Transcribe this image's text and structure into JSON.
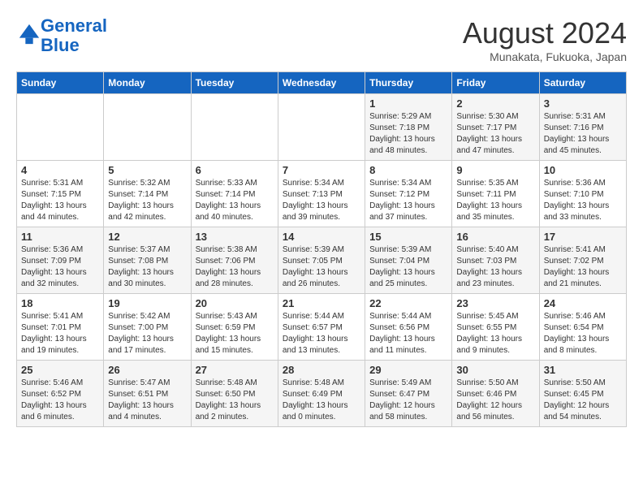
{
  "header": {
    "logo_line1": "General",
    "logo_line2": "Blue",
    "month": "August 2024",
    "location": "Munakata, Fukuoka, Japan"
  },
  "weekdays": [
    "Sunday",
    "Monday",
    "Tuesday",
    "Wednesday",
    "Thursday",
    "Friday",
    "Saturday"
  ],
  "weeks": [
    [
      {
        "day": "",
        "info": ""
      },
      {
        "day": "",
        "info": ""
      },
      {
        "day": "",
        "info": ""
      },
      {
        "day": "",
        "info": ""
      },
      {
        "day": "1",
        "info": "Sunrise: 5:29 AM\nSunset: 7:18 PM\nDaylight: 13 hours\nand 48 minutes."
      },
      {
        "day": "2",
        "info": "Sunrise: 5:30 AM\nSunset: 7:17 PM\nDaylight: 13 hours\nand 47 minutes."
      },
      {
        "day": "3",
        "info": "Sunrise: 5:31 AM\nSunset: 7:16 PM\nDaylight: 13 hours\nand 45 minutes."
      }
    ],
    [
      {
        "day": "4",
        "info": "Sunrise: 5:31 AM\nSunset: 7:15 PM\nDaylight: 13 hours\nand 44 minutes."
      },
      {
        "day": "5",
        "info": "Sunrise: 5:32 AM\nSunset: 7:14 PM\nDaylight: 13 hours\nand 42 minutes."
      },
      {
        "day": "6",
        "info": "Sunrise: 5:33 AM\nSunset: 7:14 PM\nDaylight: 13 hours\nand 40 minutes."
      },
      {
        "day": "7",
        "info": "Sunrise: 5:34 AM\nSunset: 7:13 PM\nDaylight: 13 hours\nand 39 minutes."
      },
      {
        "day": "8",
        "info": "Sunrise: 5:34 AM\nSunset: 7:12 PM\nDaylight: 13 hours\nand 37 minutes."
      },
      {
        "day": "9",
        "info": "Sunrise: 5:35 AM\nSunset: 7:11 PM\nDaylight: 13 hours\nand 35 minutes."
      },
      {
        "day": "10",
        "info": "Sunrise: 5:36 AM\nSunset: 7:10 PM\nDaylight: 13 hours\nand 33 minutes."
      }
    ],
    [
      {
        "day": "11",
        "info": "Sunrise: 5:36 AM\nSunset: 7:09 PM\nDaylight: 13 hours\nand 32 minutes."
      },
      {
        "day": "12",
        "info": "Sunrise: 5:37 AM\nSunset: 7:08 PM\nDaylight: 13 hours\nand 30 minutes."
      },
      {
        "day": "13",
        "info": "Sunrise: 5:38 AM\nSunset: 7:06 PM\nDaylight: 13 hours\nand 28 minutes."
      },
      {
        "day": "14",
        "info": "Sunrise: 5:39 AM\nSunset: 7:05 PM\nDaylight: 13 hours\nand 26 minutes."
      },
      {
        "day": "15",
        "info": "Sunrise: 5:39 AM\nSunset: 7:04 PM\nDaylight: 13 hours\nand 25 minutes."
      },
      {
        "day": "16",
        "info": "Sunrise: 5:40 AM\nSunset: 7:03 PM\nDaylight: 13 hours\nand 23 minutes."
      },
      {
        "day": "17",
        "info": "Sunrise: 5:41 AM\nSunset: 7:02 PM\nDaylight: 13 hours\nand 21 minutes."
      }
    ],
    [
      {
        "day": "18",
        "info": "Sunrise: 5:41 AM\nSunset: 7:01 PM\nDaylight: 13 hours\nand 19 minutes."
      },
      {
        "day": "19",
        "info": "Sunrise: 5:42 AM\nSunset: 7:00 PM\nDaylight: 13 hours\nand 17 minutes."
      },
      {
        "day": "20",
        "info": "Sunrise: 5:43 AM\nSunset: 6:59 PM\nDaylight: 13 hours\nand 15 minutes."
      },
      {
        "day": "21",
        "info": "Sunrise: 5:44 AM\nSunset: 6:57 PM\nDaylight: 13 hours\nand 13 minutes."
      },
      {
        "day": "22",
        "info": "Sunrise: 5:44 AM\nSunset: 6:56 PM\nDaylight: 13 hours\nand 11 minutes."
      },
      {
        "day": "23",
        "info": "Sunrise: 5:45 AM\nSunset: 6:55 PM\nDaylight: 13 hours\nand 9 minutes."
      },
      {
        "day": "24",
        "info": "Sunrise: 5:46 AM\nSunset: 6:54 PM\nDaylight: 13 hours\nand 8 minutes."
      }
    ],
    [
      {
        "day": "25",
        "info": "Sunrise: 5:46 AM\nSunset: 6:52 PM\nDaylight: 13 hours\nand 6 minutes."
      },
      {
        "day": "26",
        "info": "Sunrise: 5:47 AM\nSunset: 6:51 PM\nDaylight: 13 hours\nand 4 minutes."
      },
      {
        "day": "27",
        "info": "Sunrise: 5:48 AM\nSunset: 6:50 PM\nDaylight: 13 hours\nand 2 minutes."
      },
      {
        "day": "28",
        "info": "Sunrise: 5:48 AM\nSunset: 6:49 PM\nDaylight: 13 hours\nand 0 minutes."
      },
      {
        "day": "29",
        "info": "Sunrise: 5:49 AM\nSunset: 6:47 PM\nDaylight: 12 hours\nand 58 minutes."
      },
      {
        "day": "30",
        "info": "Sunrise: 5:50 AM\nSunset: 6:46 PM\nDaylight: 12 hours\nand 56 minutes."
      },
      {
        "day": "31",
        "info": "Sunrise: 5:50 AM\nSunset: 6:45 PM\nDaylight: 12 hours\nand 54 minutes."
      }
    ]
  ]
}
